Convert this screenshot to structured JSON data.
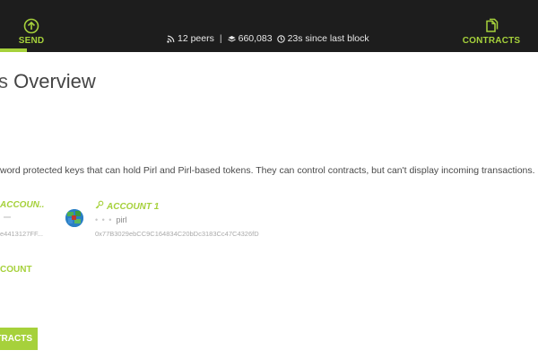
{
  "nav": {
    "send_label": "SEND",
    "contracts_label": "CONTRACTS"
  },
  "status": {
    "peers": "12 peers",
    "separator": "|",
    "block": "660,083",
    "since": "23s since last block"
  },
  "title": {
    "prefix": "s",
    "main": "Overview"
  },
  "description": "word protected keys that can hold Pirl and Pirl-based tokens. They can control contracts, but can't display incoming transactions.",
  "accounts": [
    {
      "name": "ACCOUN..",
      "address": "e4413127FF..."
    },
    {
      "name": "ACCOUNT 1",
      "balance_blurred": "• • •",
      "unit": "pirl",
      "address": "0x77B3029ebCC9C164834C20bDc3183Cc47C4326fD"
    }
  ],
  "add_account_label": "COUNT",
  "contracts_button_label": "TRACTS",
  "colors": {
    "accent": "#a6d13b",
    "topbar": "#1d1d1d"
  },
  "icons": {
    "send": "arrow-up-circle-icon",
    "contracts": "documents-icon",
    "peers": "rss-icon",
    "block": "layers-icon",
    "clock": "clock-icon",
    "key": "key-icon"
  }
}
